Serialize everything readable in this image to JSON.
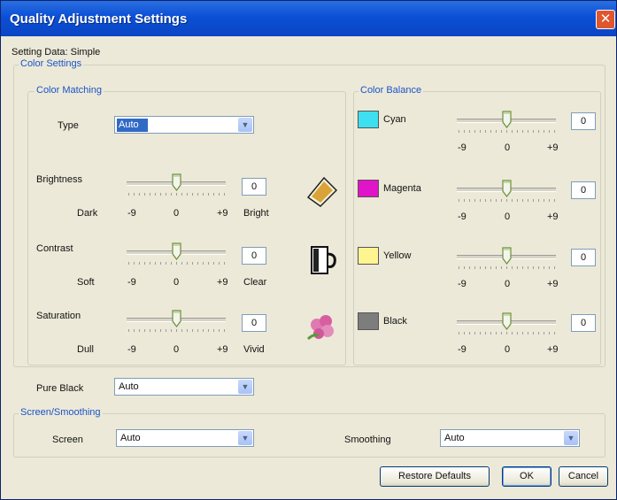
{
  "window": {
    "title": "Quality Adjustment Settings",
    "close_glyph": "✕"
  },
  "setting_data": "Setting Data: Simple",
  "color_settings": {
    "title": "Color Settings",
    "color_matching": {
      "title": "Color Matching",
      "type_label": "Type",
      "type_value": "Auto",
      "sliders": [
        {
          "label": "Brightness",
          "value": "0",
          "level": 0,
          "min": "-9",
          "mid": "0",
          "max": "+9",
          "left": "Dark",
          "right": "Bright",
          "icon": "brightness-icon"
        },
        {
          "label": "Contrast",
          "value": "0",
          "level": 0,
          "min": "-9",
          "mid": "0",
          "max": "+9",
          "left": "Soft",
          "right": "Clear",
          "icon": "contrast-icon"
        },
        {
          "label": "Saturation",
          "value": "0",
          "level": 0,
          "min": "-9",
          "mid": "0",
          "max": "+9",
          "left": "Dull",
          "right": "Vivid",
          "icon": "saturation-icon"
        }
      ]
    },
    "color_balance": {
      "title": "Color Balance",
      "items": [
        {
          "label": "Cyan",
          "value": "0",
          "level": 0,
          "color": "#3de0f0",
          "min": "-9",
          "mid": "0",
          "max": "+9"
        },
        {
          "label": "Magenta",
          "value": "0",
          "level": 0,
          "color": "#e014c8",
          "min": "-9",
          "mid": "0",
          "max": "+9"
        },
        {
          "label": "Yellow",
          "value": "0",
          "level": 0,
          "color": "#fff590",
          "min": "-9",
          "mid": "0",
          "max": "+9"
        },
        {
          "label": "Black",
          "value": "0",
          "level": 0,
          "color": "#7d7d7d",
          "min": "-9",
          "mid": "0",
          "max": "+9"
        }
      ]
    },
    "pure_black": {
      "label": "Pure Black",
      "value": "Auto"
    }
  },
  "screen_smoothing": {
    "title": "Screen/Smoothing",
    "screen_label": "Screen",
    "screen_value": "Auto",
    "smoothing_label": "Smoothing",
    "smoothing_value": "Auto"
  },
  "buttons": {
    "restore": "Restore Defaults",
    "ok": "OK",
    "cancel": "Cancel"
  },
  "colors": {
    "titlebar": "#0b4fd6",
    "group_title": "#1b52c8",
    "face": "#ece9d8"
  }
}
